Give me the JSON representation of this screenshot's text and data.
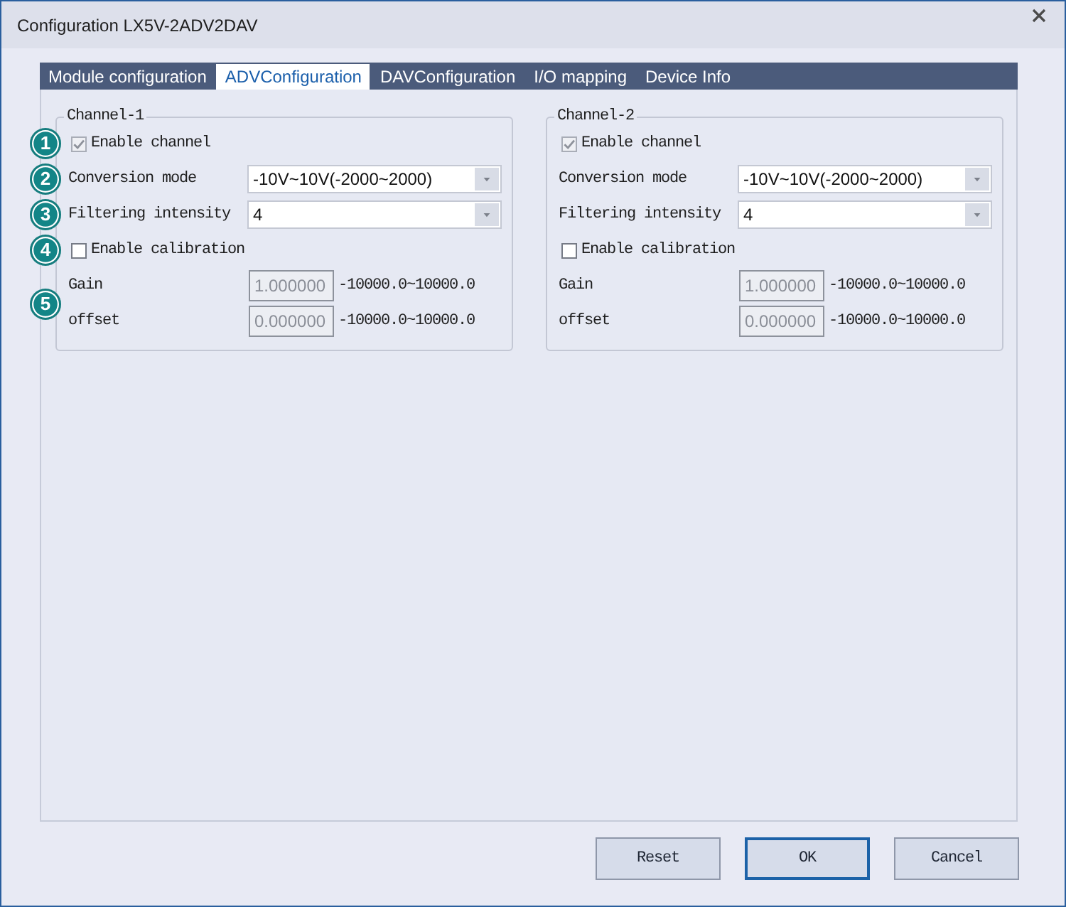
{
  "window": {
    "title": "Configuration LX5V-2ADV2DAV"
  },
  "tabs": [
    {
      "label": "Module configuration",
      "selected": false
    },
    {
      "label": "ADVConfiguration",
      "selected": true
    },
    {
      "label": "DAVConfiguration",
      "selected": false
    },
    {
      "label": "I/O mapping",
      "selected": false
    },
    {
      "label": "Device Info",
      "selected": false
    }
  ],
  "channels": [
    {
      "title": "Channel-1",
      "rows": [
        {
          "kind": "checkbox",
          "label": "Enable channel",
          "checked": true,
          "disabled": true,
          "callout": "1"
        },
        {
          "kind": "dropdown",
          "label": "Conversion mode",
          "value": "-10V~10V(-2000~2000)",
          "callout": "2"
        },
        {
          "kind": "dropdown",
          "label": "Filtering intensity",
          "value": "4",
          "callout": "3"
        },
        {
          "kind": "checkbox",
          "label": "Enable calibration",
          "checked": false,
          "disabled": false,
          "callout": "4"
        },
        {
          "kind": "number_group",
          "callout": "5",
          "fields": [
            {
              "label": "Gain",
              "value": "1.000000",
              "range": "-10000.0~10000.0",
              "disabled": true
            },
            {
              "label": "offset",
              "value": "0.000000",
              "range": "-10000.0~10000.0",
              "disabled": true
            }
          ]
        }
      ]
    },
    {
      "title": "Channel-2",
      "rows": [
        {
          "kind": "checkbox",
          "label": "Enable channel",
          "checked": true,
          "disabled": true
        },
        {
          "kind": "dropdown",
          "label": "Conversion mode",
          "value": "-10V~10V(-2000~2000)"
        },
        {
          "kind": "dropdown",
          "label": "Filtering intensity",
          "value": "4"
        },
        {
          "kind": "checkbox",
          "label": "Enable calibration",
          "checked": false,
          "disabled": false
        },
        {
          "kind": "number_group",
          "fields": [
            {
              "label": "Gain",
              "value": "1.000000",
              "range": "-10000.0~10000.0",
              "disabled": true
            },
            {
              "label": "offset",
              "value": "0.000000",
              "range": "-10000.0~10000.0",
              "disabled": true
            }
          ]
        }
      ]
    }
  ],
  "buttons": [
    {
      "label": "Reset",
      "default": false
    },
    {
      "label": "OK",
      "default": true
    },
    {
      "label": "Cancel",
      "default": false
    }
  ]
}
